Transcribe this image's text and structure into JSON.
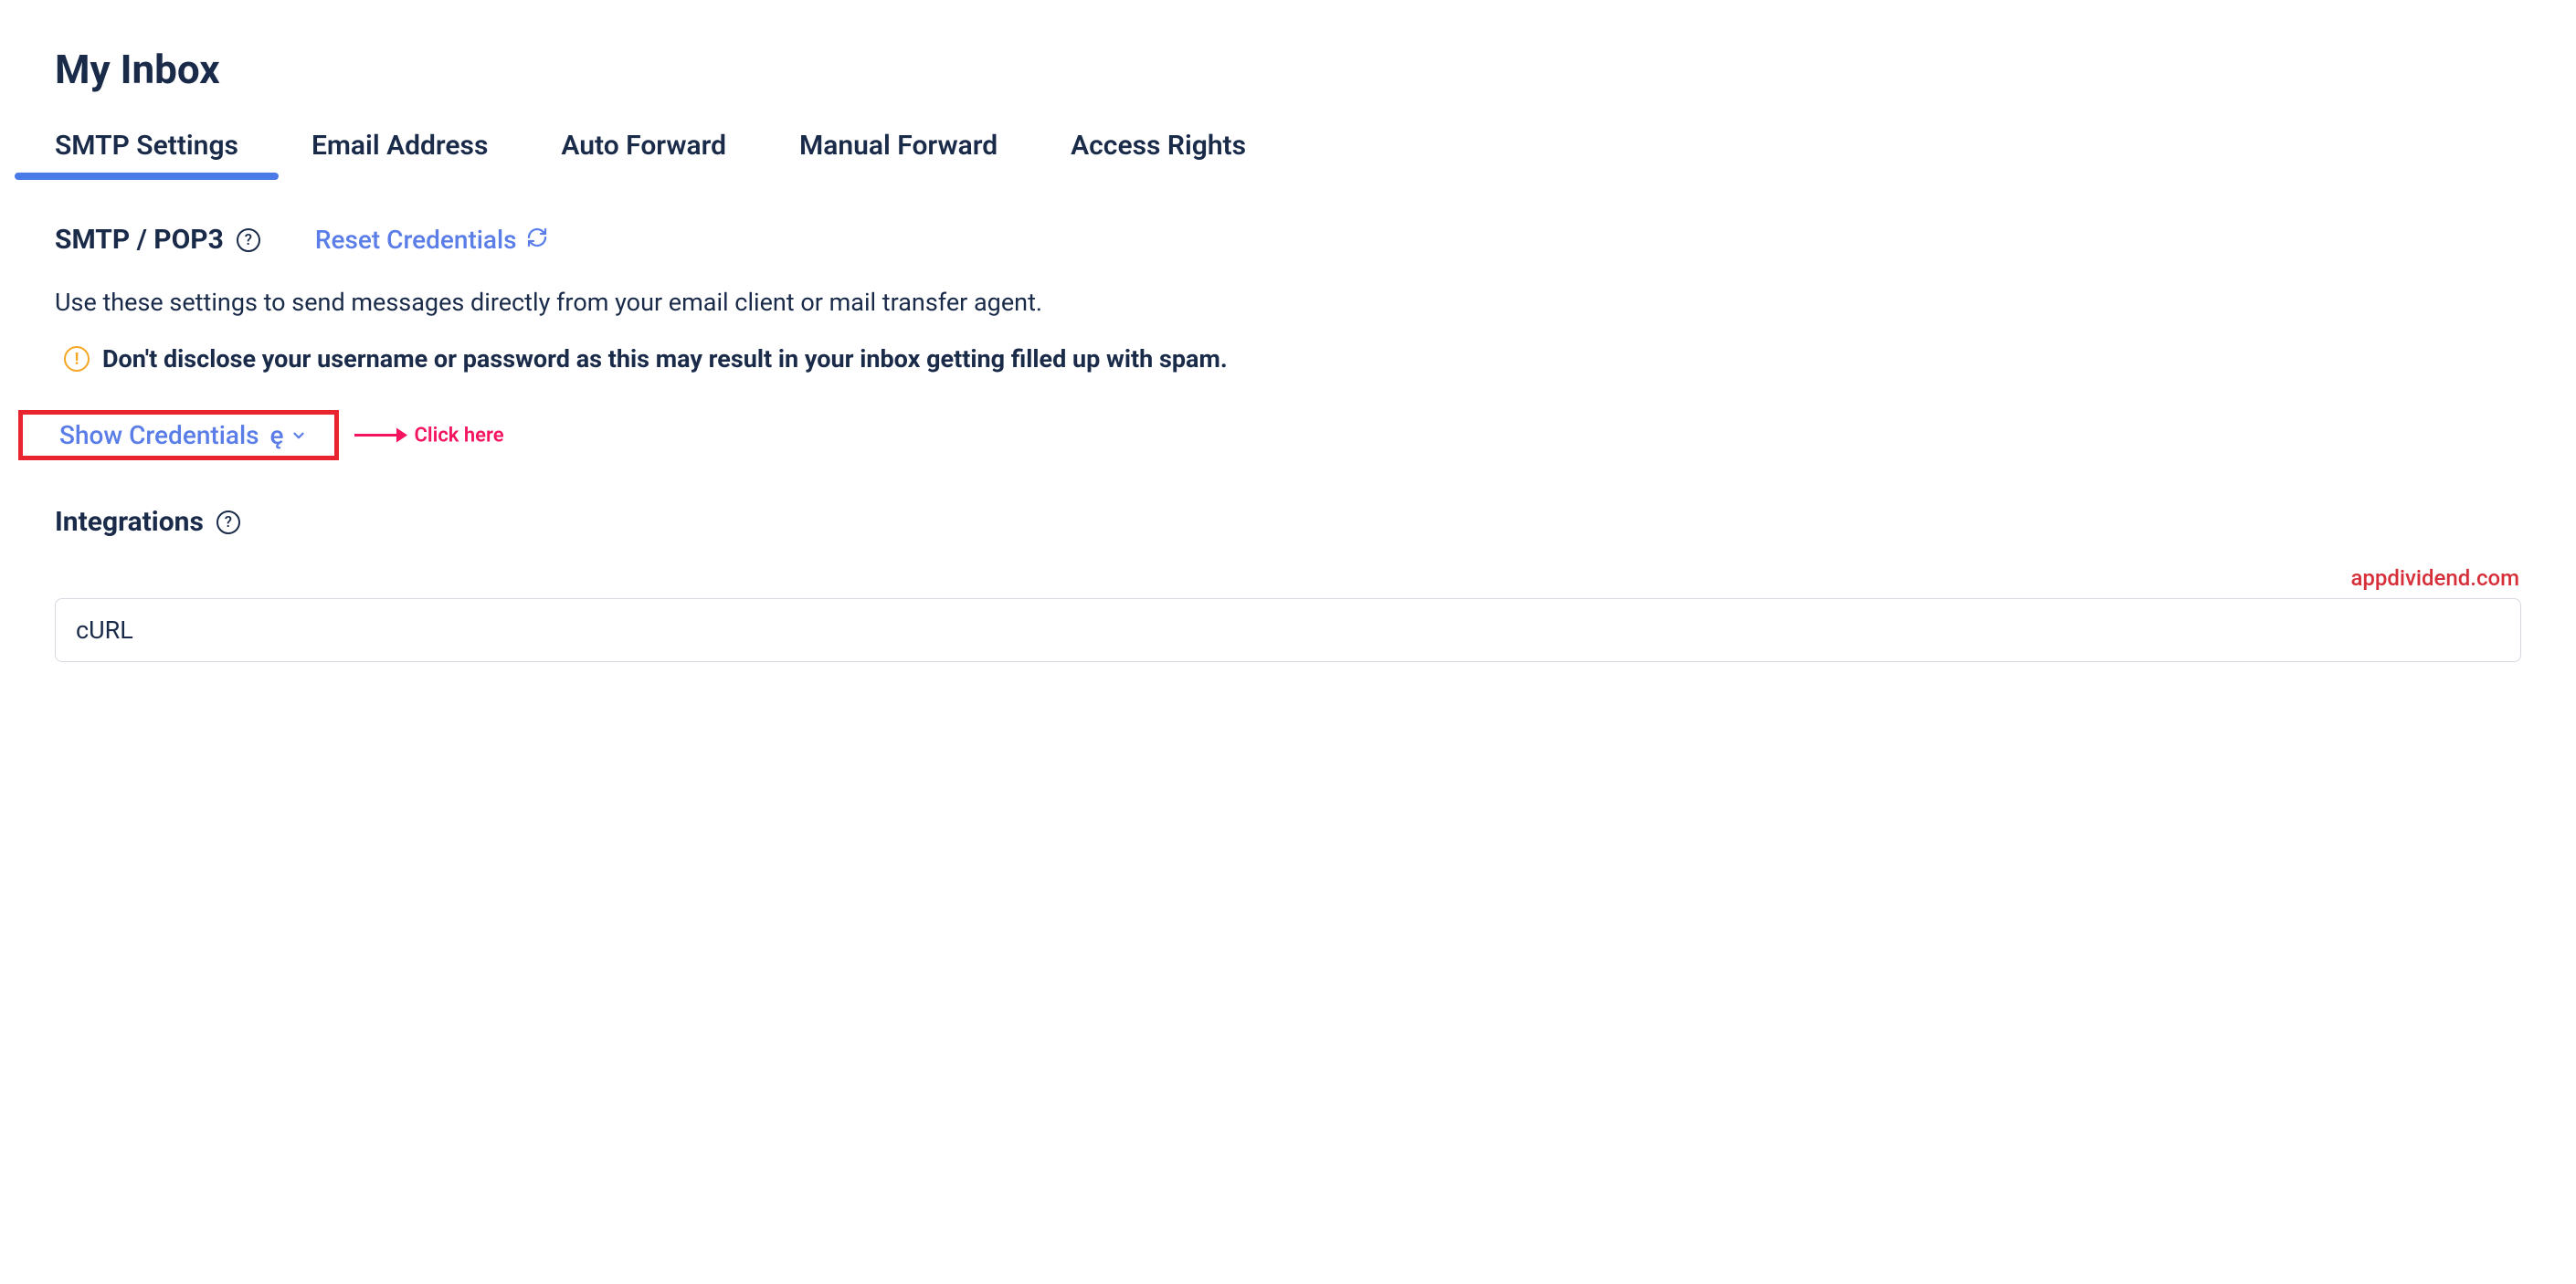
{
  "header": {
    "title": "My Inbox"
  },
  "tabs": [
    {
      "label": "SMTP Settings",
      "active": true
    },
    {
      "label": "Email Address",
      "active": false
    },
    {
      "label": "Auto Forward",
      "active": false
    },
    {
      "label": "Manual Forward",
      "active": false
    },
    {
      "label": "Access Rights",
      "active": false
    }
  ],
  "smtp": {
    "heading": "SMTP / POP3",
    "reset_label": "Reset Credentials",
    "description": "Use these settings to send messages directly from your email client or mail transfer agent.",
    "warning": "Don't disclose your username or password as this may result in your inbox getting filled up with spam.",
    "show_credentials_label": "Show Credentials"
  },
  "annotation": {
    "click_here": "Click here"
  },
  "integrations": {
    "heading": "Integrations",
    "selected": "cURL"
  },
  "watermark": "appdividend.com",
  "icons": {
    "help": "?",
    "warning": "!"
  }
}
